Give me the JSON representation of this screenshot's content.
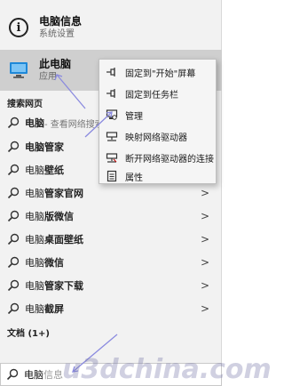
{
  "top_results": [
    {
      "title": "电脑信息",
      "subtitle": "系统设置",
      "icon": "info-icon"
    },
    {
      "title": "此电脑",
      "subtitle": "应用",
      "icon": "computer-icon"
    }
  ],
  "web_section_title": "搜索网页",
  "web_suggestions": [
    {
      "bold": "电脑",
      "rest": "",
      "extra": " - 查看网络搜索结果"
    },
    {
      "bold": "电脑",
      "rest": "管家",
      "extra": ""
    },
    {
      "bold": "电脑",
      "rest": "壁纸",
      "extra": ""
    },
    {
      "bold": "电脑",
      "rest": "管家官网",
      "extra": ""
    },
    {
      "bold": "电脑",
      "rest": "版微信",
      "extra": ""
    },
    {
      "bold": "电脑",
      "rest": "桌面壁纸",
      "extra": ""
    },
    {
      "bold": "电脑",
      "rest": "微信",
      "extra": ""
    },
    {
      "bold": "电脑",
      "rest": "管家下载",
      "extra": ""
    },
    {
      "bold": "电脑",
      "rest": "截屏",
      "extra": ""
    }
  ],
  "chevron": ">",
  "docs_section_title": "文档 (1+)",
  "search": {
    "typed": "电脑",
    "ghost": "信息"
  },
  "context_menu": [
    {
      "label": "固定到\"开始\"屏幕",
      "icon": "pin-icon"
    },
    {
      "label": "固定到任务栏",
      "icon": "pin-icon"
    },
    {
      "label": "管理",
      "icon": "manage-icon"
    },
    {
      "label": "映射网络驱动器",
      "icon": "network-drive-icon"
    },
    {
      "label": "断开网络驱动器的连接",
      "icon": "disconnect-drive-icon"
    },
    {
      "label": "属性",
      "icon": "properties-icon"
    }
  ],
  "watermark": "u3dchina.com",
  "colors": {
    "panel": "#f2f2f2",
    "selected": "#cfcfcf",
    "arrow": "#8a8adf"
  }
}
